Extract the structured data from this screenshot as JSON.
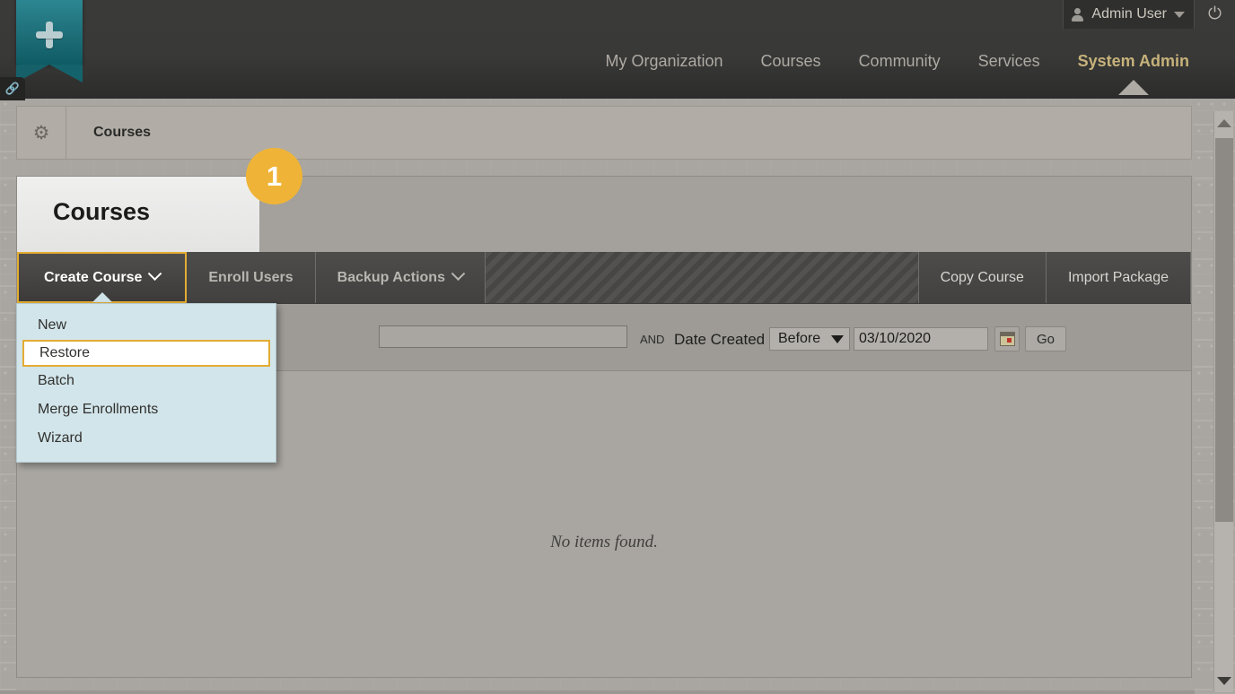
{
  "header": {
    "logo_icon": "plus-bookmark-logo",
    "link_icon": "link-icon",
    "user": {
      "name": "Admin User",
      "avatar_icon": "user-avatar-icon",
      "caret_icon": "chevron-down-icon"
    },
    "power_icon": "power-icon",
    "power_glyph": "⏻",
    "nav": [
      {
        "label": "My Organization",
        "active": false
      },
      {
        "label": "Courses",
        "active": false
      },
      {
        "label": "Community",
        "active": false
      },
      {
        "label": "Services",
        "active": false
      },
      {
        "label": "System Admin",
        "active": true
      }
    ]
  },
  "breadcrumb": {
    "gear_icon": "gear-icon",
    "gear_glyph": "✿",
    "label": "Courses"
  },
  "page": {
    "title": "Courses",
    "step_badge": "1"
  },
  "action_bar": {
    "buttons": [
      {
        "name": "create-course",
        "label": "Create Course",
        "has_caret": true,
        "state": "active"
      },
      {
        "name": "enroll-users",
        "label": "Enroll Users",
        "has_caret": false,
        "state": "normal"
      },
      {
        "name": "backup-actions",
        "label": "Backup Actions",
        "has_caret": true,
        "state": "normal"
      }
    ],
    "right_buttons": [
      {
        "name": "copy-course",
        "label": "Copy Course"
      },
      {
        "name": "import-package",
        "label": "Import Package"
      }
    ]
  },
  "dropdown": {
    "open": true,
    "items": [
      {
        "label": "New",
        "selected": false
      },
      {
        "label": "Restore",
        "selected": true
      },
      {
        "label": "Batch",
        "selected": false
      },
      {
        "label": "Merge Enrollments",
        "selected": false
      },
      {
        "label": "Wizard",
        "selected": false
      }
    ]
  },
  "filter": {
    "search_value": "",
    "search_placeholder": "",
    "and_label": "AND",
    "field_label": "Date Created",
    "operator": "Before",
    "operator_caret_icon": "triangle-down-icon",
    "date_value": "03/10/2020",
    "calendar_icon": "calendar-icon",
    "go_label": "Go"
  },
  "results": {
    "empty_message": "No items found."
  },
  "scrollbar": {
    "up_icon": "triangle-up-icon",
    "down_icon": "triangle-down-icon"
  },
  "colors": {
    "accent_gold": "#e3ac33",
    "badge_gold": "#efb437",
    "nav_active": "#c6b27a",
    "dropdown_bg": "#d2e5ea",
    "logo_teal": "#1d6d77"
  }
}
